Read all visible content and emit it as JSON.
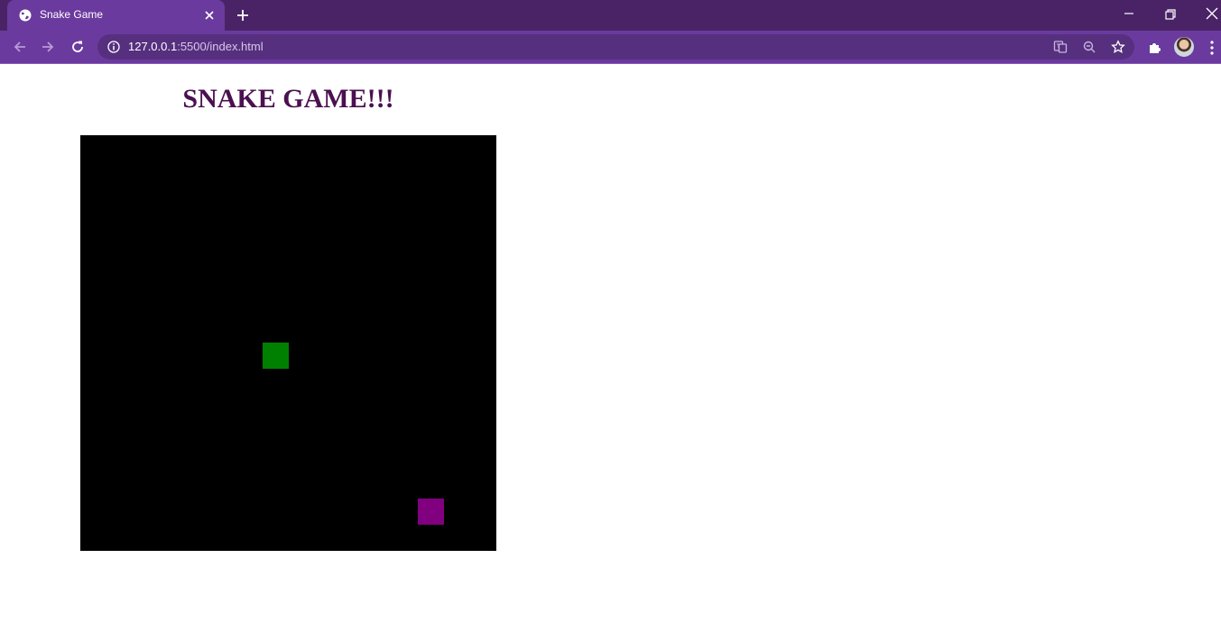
{
  "browser": {
    "tab": {
      "title": "Snake Game"
    },
    "address": {
      "host": "127.0.0.1",
      "rest": ":5500/index.html"
    }
  },
  "page": {
    "heading": "SNAKE GAME!!!"
  },
  "game": {
    "background_color": "#000000",
    "snake": {
      "color": "#008000",
      "segments": [
        {
          "col": 7,
          "row": 8
        }
      ]
    },
    "food": {
      "color": "#800080",
      "col": 13,
      "row": 14
    }
  },
  "theme": {
    "frame_color": "#4a2366",
    "toolbar_color": "#6b3a9e",
    "heading_color": "#4a1050"
  }
}
